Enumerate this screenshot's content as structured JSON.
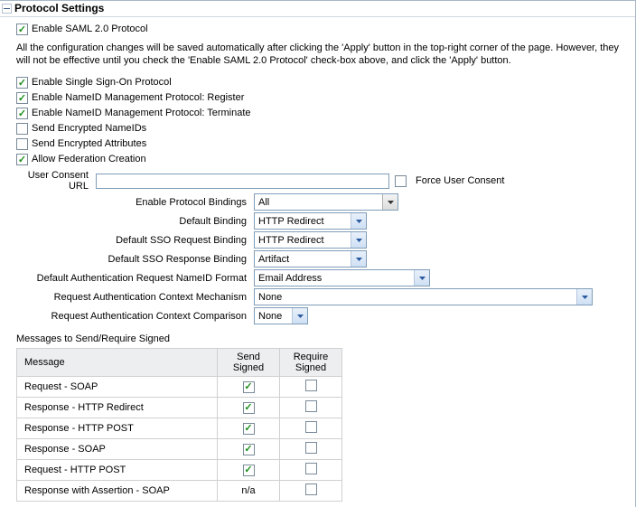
{
  "header": {
    "title": "Protocol Settings"
  },
  "checkboxes": {
    "enable_saml": {
      "label": "Enable SAML 2.0 Protocol",
      "checked": true
    },
    "enable_sso": {
      "label": "Enable Single Sign-On Protocol",
      "checked": true
    },
    "nameid_register": {
      "label": "Enable NameID Management Protocol: Register",
      "checked": true
    },
    "nameid_terminate": {
      "label": "Enable NameID Management Protocol: Terminate",
      "checked": true
    },
    "send_enc_nameids": {
      "label": "Send Encrypted NameIDs",
      "checked": false
    },
    "send_enc_attrs": {
      "label": "Send Encrypted Attributes",
      "checked": false
    },
    "allow_fed": {
      "label": "Allow Federation Creation",
      "checked": true
    },
    "force_consent": {
      "label": "Force User Consent",
      "checked": false
    }
  },
  "helptext": "All the configuration changes will be saved automatically after clicking the 'Apply' button in the top-right corner of the page. However, they will not be effective until you check the 'Enable SAML 2.0 Protocol' check-box above, and click the 'Apply' button.",
  "fields": {
    "user_consent_url": {
      "label": "User Consent URL",
      "value": ""
    },
    "enable_bindings": {
      "label": "Enable Protocol Bindings",
      "value": "All"
    },
    "default_binding": {
      "label": "Default Binding",
      "value": "HTTP Redirect"
    },
    "default_sso_req": {
      "label": "Default SSO Request Binding",
      "value": "HTTP Redirect"
    },
    "default_sso_resp": {
      "label": "Default SSO Response Binding",
      "value": "Artifact"
    },
    "default_authn_nameid": {
      "label": "Default Authentication Request NameID Format",
      "value": "Email Address"
    },
    "req_authn_mech": {
      "label": "Request Authentication Context Mechanism",
      "value": "None"
    },
    "req_authn_cmp": {
      "label": "Request Authentication Context Comparison",
      "value": "None"
    }
  },
  "messages_table": {
    "title": "Messages to Send/Require Signed",
    "headers": {
      "msg": "Message",
      "send": "Send Signed",
      "require": "Require Signed"
    },
    "rows": [
      {
        "msg": "Request - SOAP",
        "send": true,
        "require": false
      },
      {
        "msg": "Response - HTTP Redirect",
        "send": true,
        "require": false
      },
      {
        "msg": "Response - HTTP POST",
        "send": true,
        "require": false
      },
      {
        "msg": "Response - SOAP",
        "send": true,
        "require": false
      },
      {
        "msg": "Request - HTTP POST",
        "send": true,
        "require": false
      },
      {
        "msg": "Response with Assertion - SOAP",
        "send": "n/a",
        "require": false
      }
    ]
  }
}
